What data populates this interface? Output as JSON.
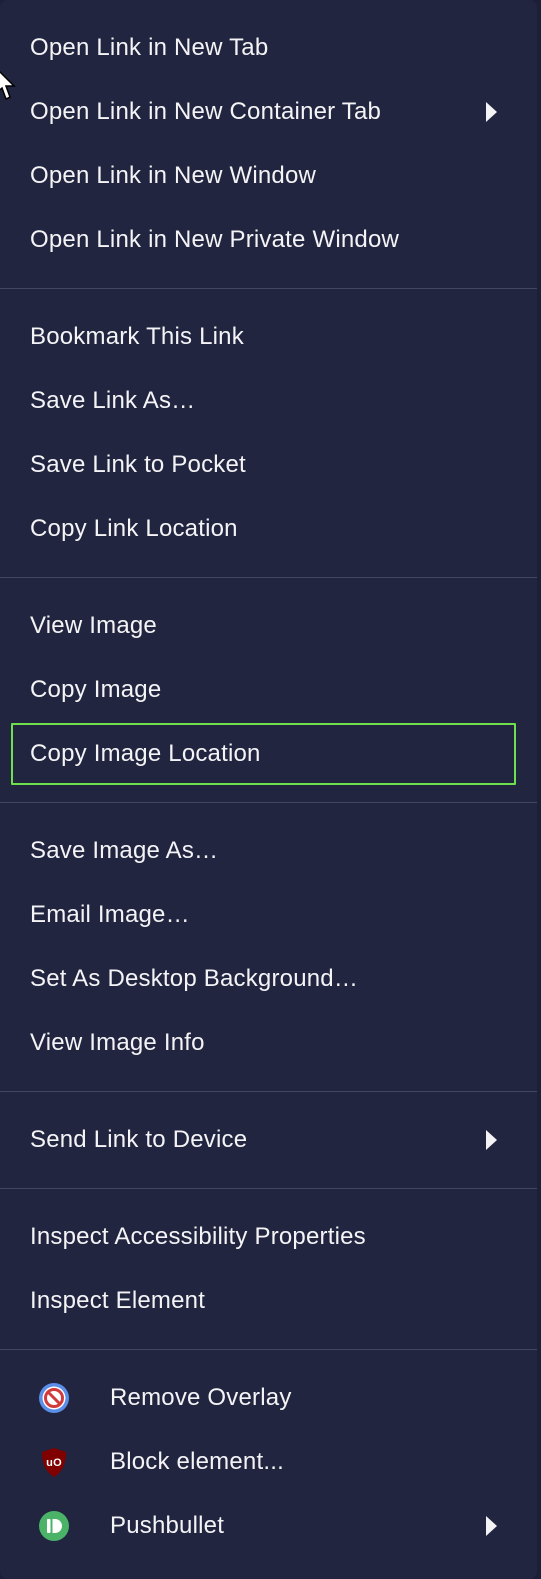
{
  "menu": {
    "group1": {
      "open_new_tab": "Open Link in New Tab",
      "open_container_tab": "Open Link in New Container Tab",
      "open_new_window": "Open Link in New Window",
      "open_private_window": "Open Link in New Private Window"
    },
    "group2": {
      "bookmark_link": "Bookmark This Link",
      "save_link_as": "Save Link As…",
      "save_to_pocket": "Save Link to Pocket",
      "copy_link_location": "Copy Link Location"
    },
    "group3": {
      "view_image": "View Image",
      "copy_image": "Copy Image",
      "copy_image_location": "Copy Image Location"
    },
    "group4": {
      "save_image_as": "Save Image As…",
      "email_image": "Email Image…",
      "set_desktop_background": "Set As Desktop Background…",
      "view_image_info": "View Image Info"
    },
    "group5": {
      "send_link_to_device": "Send Link to Device"
    },
    "group6": {
      "inspect_accessibility": "Inspect Accessibility Properties",
      "inspect_element": "Inspect Element"
    },
    "group7": {
      "remove_overlay": "Remove Overlay",
      "block_element": "Block element...",
      "pushbullet": "Pushbullet"
    }
  },
  "icons": {
    "remove_overlay": "no-entry-icon",
    "block_element": "ublock-origin-shield-icon",
    "pushbullet": "pushbullet-icon",
    "submenu": "chevron-right-icon",
    "cursor": "mouse-pointer-icon"
  },
  "colors": {
    "menu_background": "#22253f",
    "text": "#f4f4f7",
    "separator": "#43465f",
    "highlight_outline": "#6ee04c",
    "ublock_red": "#800000",
    "pushbullet_green": "#4ab367",
    "remove_overlay_blue": "#5a8ee8"
  }
}
